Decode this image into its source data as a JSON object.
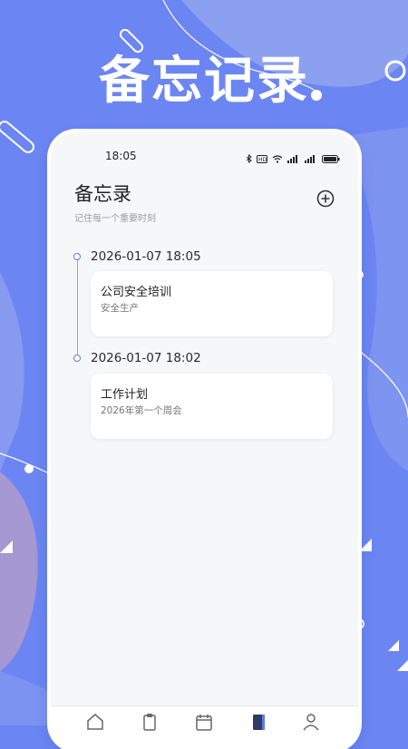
{
  "promo": {
    "title": "备忘记录"
  },
  "status_bar": {
    "time": "18:05"
  },
  "header": {
    "title": "备忘录",
    "subtitle": "记住每一个重要时刻",
    "add_icon": "plus-circle-icon"
  },
  "memos": [
    {
      "time": "2026-01-07 18:05",
      "title": "公司安全培训",
      "content": "安全生产"
    },
    {
      "time": "2026-01-07 18:02",
      "title": "工作计划",
      "content": "2026年第一个周会"
    }
  ],
  "bottom_nav": {
    "items": [
      {
        "icon": "home-icon",
        "active": false
      },
      {
        "icon": "clipboard-icon",
        "active": false
      },
      {
        "icon": "calendar-icon",
        "active": false
      },
      {
        "icon": "notebook-icon",
        "active": true
      },
      {
        "icon": "person-icon",
        "active": false
      }
    ]
  },
  "colors": {
    "background": "#6b86f2",
    "accent": "#5f79e8",
    "phone_bg": "#f6f7f9"
  }
}
